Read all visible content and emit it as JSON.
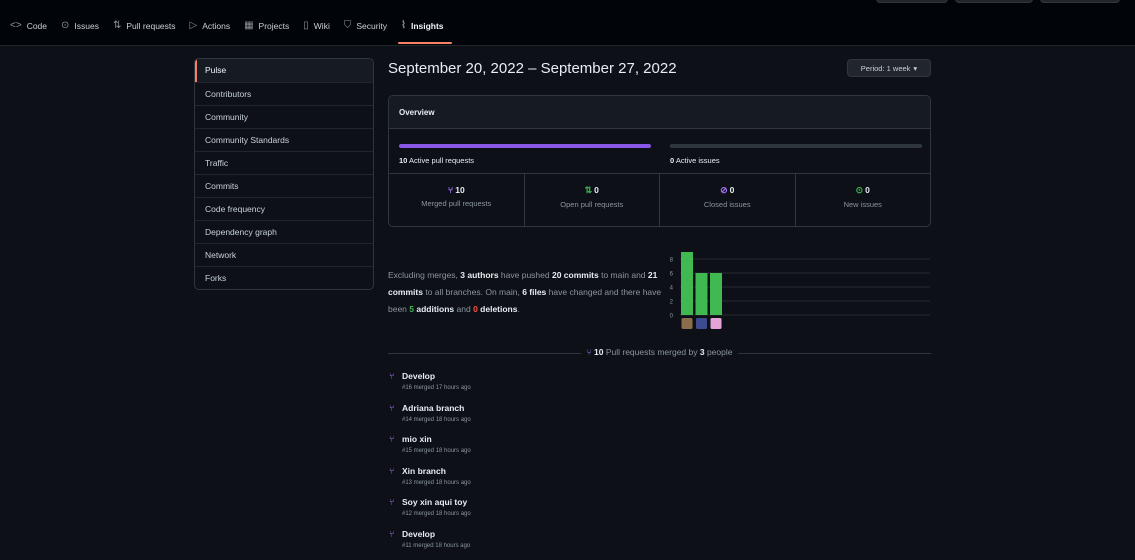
{
  "nav": {
    "items": [
      {
        "label": "Code",
        "icon": "code-icon",
        "glyph": "<>"
      },
      {
        "label": "Issues",
        "icon": "issue-icon",
        "glyph": "⊙"
      },
      {
        "label": "Pull requests",
        "icon": "pull-request-icon",
        "glyph": "⇅"
      },
      {
        "label": "Actions",
        "icon": "play-icon",
        "glyph": "▷"
      },
      {
        "label": "Projects",
        "icon": "table-icon",
        "glyph": "▦"
      },
      {
        "label": "Wiki",
        "icon": "book-icon",
        "glyph": "▯"
      },
      {
        "label": "Security",
        "icon": "shield-icon",
        "glyph": "⛉"
      },
      {
        "label": "Insights",
        "icon": "graph-icon",
        "glyph": "⌇"
      }
    ]
  },
  "sidebar": {
    "items": [
      {
        "label": "Pulse"
      },
      {
        "label": "Contributors"
      },
      {
        "label": "Community"
      },
      {
        "label": "Community Standards"
      },
      {
        "label": "Traffic"
      },
      {
        "label": "Commits"
      },
      {
        "label": "Code frequency"
      },
      {
        "label": "Dependency graph"
      },
      {
        "label": "Network"
      },
      {
        "label": "Forks"
      }
    ]
  },
  "header": {
    "title": "September 20, 2022 – September 27, 2022",
    "period_button": "Period: 1 week",
    "period_caret": "▾"
  },
  "overview": {
    "title": "Overview",
    "pr_bar_fraction": 1.0,
    "issue_bar_fraction": 0.0,
    "active_prs_count": "10",
    "active_prs_label": "Active pull requests",
    "active_issues_count": "0",
    "active_issues_label": "Active issues",
    "stats": [
      {
        "count": "10",
        "label": "Merged pull requests",
        "icon": "git-merge-icon",
        "glyph": "⑂",
        "color": "#a371f7"
      },
      {
        "count": "0",
        "label": "Open pull requests",
        "icon": "git-pull-request-icon",
        "glyph": "⇅",
        "color": "#3fb950"
      },
      {
        "count": "0",
        "label": "Closed issues",
        "icon": "issue-closed-icon",
        "glyph": "⊘",
        "color": "#a371f7"
      },
      {
        "count": "0",
        "label": "New issues",
        "icon": "issue-opened-icon",
        "glyph": "⊙",
        "color": "#3fb950"
      }
    ]
  },
  "summary": {
    "p1": "Excluding merges, ",
    "authors": "3 authors",
    "p2": " have pushed ",
    "commits_main": "20 commits",
    "p3": " to main and ",
    "commits_all": "21 commits",
    "p4": " to all branches. On main, ",
    "files": "6 files",
    "p5": " have changed and there have been ",
    "additions_n": "5",
    "additions_w": " additions",
    "p6": " and ",
    "deletions_n": "0",
    "deletions_w": " deletions",
    "p7": "."
  },
  "chart_data": {
    "type": "bar",
    "categories": [
      "author-1",
      "author-2",
      "author-3"
    ],
    "values": [
      9,
      6,
      6
    ],
    "ylim": [
      0,
      9
    ],
    "yticks": [
      0,
      2,
      4,
      6,
      8
    ],
    "grid": true,
    "bar_color": "#3fb950",
    "avatar_colors": [
      "#8a6d4a",
      "#3d4b8f",
      "#e6a3d6"
    ]
  },
  "merged": {
    "icon": "git-merge-icon",
    "glyph": "⑂",
    "count": "10",
    "mid": " Pull requests merged by ",
    "people": "3",
    "end": " people"
  },
  "pull_requests": [
    {
      "title": "Develop",
      "meta": "#16 merged 17 hours ago"
    },
    {
      "title": "Adriana branch",
      "meta": "#14 merged 18 hours ago"
    },
    {
      "title": "mio xin",
      "meta": "#15 merged 18 hours ago"
    },
    {
      "title": "Xin branch",
      "meta": "#13 merged 18 hours ago"
    },
    {
      "title": "Soy xin aqui toy",
      "meta": "#12 merged 18 hours ago"
    },
    {
      "title": "Develop",
      "meta": "#11 merged 18 hours ago"
    }
  ]
}
